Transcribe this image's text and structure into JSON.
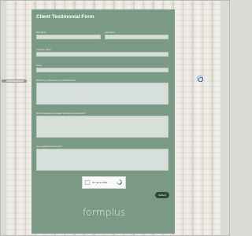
{
  "form": {
    "title": "Client Testimonial Form",
    "first_name_label": "First Name",
    "last_name_label": "Last Name",
    "company_label": "Company Name",
    "email_label": "Email",
    "q1_label": "What do you like about our product/service?",
    "q2_label": "Which challenges are solved with this product/service?",
    "q3_label": "Any suggestions/comments?",
    "captcha_label": "I'm not a robot",
    "submit_label": "Submit",
    "brand": "formplus"
  },
  "colors": {
    "card_bg": "#7a9a85",
    "field_bg": "#d7dfda",
    "submit_bg": "#2f4a3a"
  },
  "icons": [
    "recaptcha-icon",
    "accessibility-icon"
  ]
}
